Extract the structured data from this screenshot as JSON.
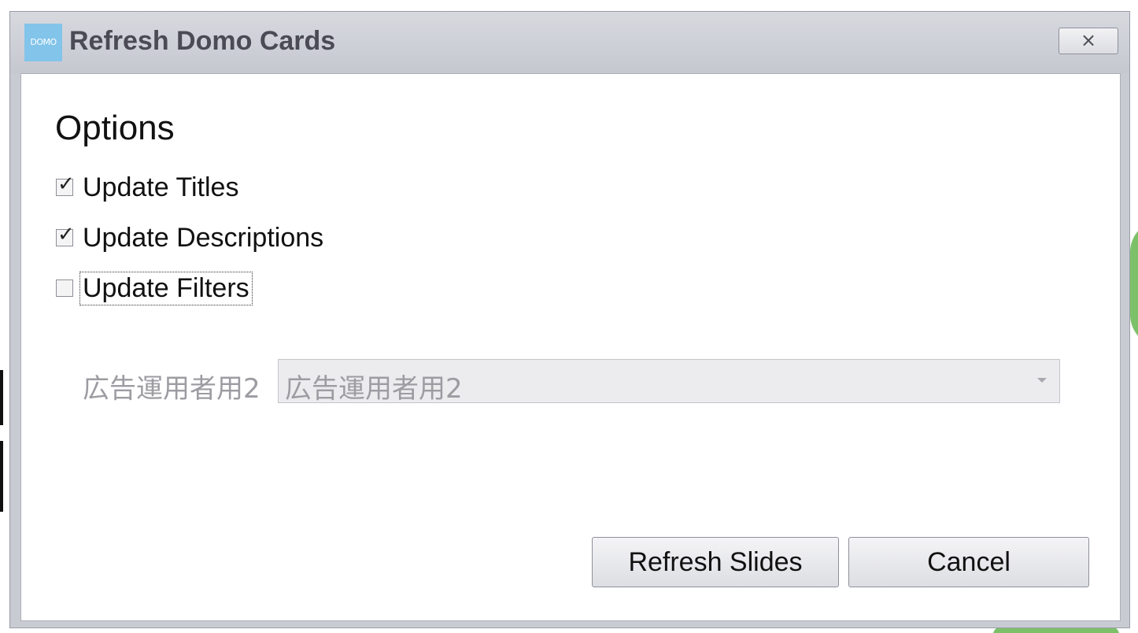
{
  "window": {
    "logo_text": "DOMO",
    "title": "Refresh Domo Cards",
    "close_symbol": "×"
  },
  "options": {
    "heading": "Options",
    "items": [
      {
        "label": "Update Titles",
        "checked": true
      },
      {
        "label": "Update Descriptions",
        "checked": true
      },
      {
        "label": "Update Filters",
        "checked": false,
        "focused": true
      }
    ]
  },
  "filter": {
    "label": "広告運用者用2",
    "selected": "広告運用者用2",
    "disabled": true
  },
  "buttons": {
    "refresh_label": "Refresh Slides",
    "cancel_label": "Cancel"
  },
  "icons": {
    "close": "close-icon",
    "checkbox_checked": "check-icon",
    "dropdown": "chevron-down-icon"
  },
  "colors": {
    "titlebar": "#c9cbd3",
    "logo": "#82c4ea",
    "title_text": "#4a4b55",
    "disabled_text": "#9c9ca2"
  }
}
